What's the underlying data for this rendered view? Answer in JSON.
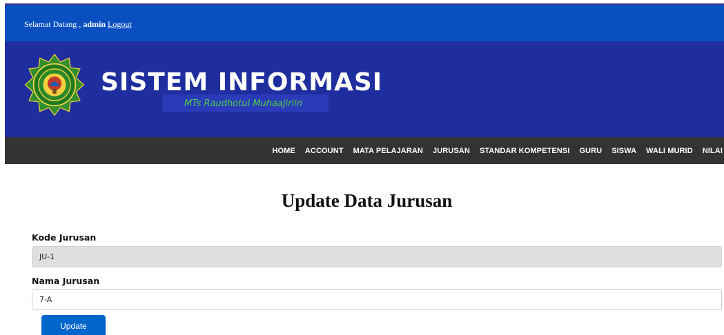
{
  "topbar": {
    "welcome_text": "Selamat Datang ,",
    "username": "admin",
    "logout_label": "Logout"
  },
  "banner": {
    "title": "SISTEM INFORMASI",
    "subtitle": "MTs Raudhotul Muhaajiriin",
    "logo_icon": "school-emblem-icon"
  },
  "nav": {
    "items": [
      {
        "label": "HOME"
      },
      {
        "label": "ACCOUNT"
      },
      {
        "label": "MATA PELAJARAN"
      },
      {
        "label": "JURUSAN"
      },
      {
        "label": "STANDAR KOMPETENSI"
      },
      {
        "label": "GURU"
      },
      {
        "label": "SISWA"
      },
      {
        "label": "WALI MURID"
      },
      {
        "label": "NILAI"
      }
    ]
  },
  "page": {
    "title": "Update Data Jurusan"
  },
  "form": {
    "kode_label": "Kode Jurusan",
    "kode_value": "JU-1",
    "nama_label": "Nama Jurusan",
    "nama_value": "7-A",
    "submit_label": "Update"
  },
  "colors": {
    "topbar": "#0a4fc0",
    "banner": "#1f2e9e",
    "navbar": "#333333",
    "button": "#0066cc",
    "subtitle": "#4fd04a"
  }
}
